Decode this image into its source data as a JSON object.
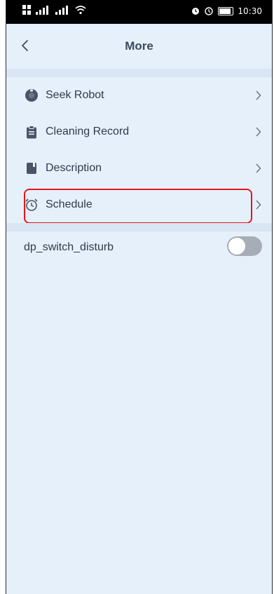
{
  "status_bar": {
    "left_glyphs": "▒▒ ‥‥░░ ‥‥░░",
    "time": "10:30"
  },
  "header": {
    "title": "More",
    "back_icon": "chevron-left-icon"
  },
  "menu": {
    "items": [
      {
        "label": "Seek Robot",
        "icon": "robot-icon"
      },
      {
        "label": "Cleaning Record",
        "icon": "clipboard-icon"
      },
      {
        "label": "Description",
        "icon": "book-icon"
      },
      {
        "label": "Schedule",
        "icon": "alarm-clock-icon"
      }
    ]
  },
  "settings": {
    "switch_label": "dp_switch_disturb",
    "switch_on": false
  },
  "colors": {
    "background": "#e6f0fb",
    "separator": "#d9e5f3",
    "text": "#2f3a4c",
    "highlight": "#e01818",
    "toggle_off": "#a7adb6"
  }
}
